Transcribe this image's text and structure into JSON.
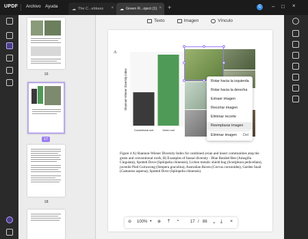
{
  "app": {
    "logo": "UPDF",
    "menu": [
      "Archivo",
      "Ayuda"
    ],
    "tabs": [
      {
        "label": "The C...ebkass"
      },
      {
        "label": "Green R...oject (1)"
      }
    ],
    "avatar_initial": "C"
  },
  "toolbar": {
    "text_label": "Texto",
    "image_label": "Imagen",
    "link_label": "Vínculo"
  },
  "thumbnails": {
    "pages": [
      "16",
      "17",
      "18"
    ],
    "selected_page": "17"
  },
  "document": {
    "figure_label": "A",
    "y_axis_label": "Shannon-Wiener Diversity Index",
    "x_categories": [
      "Conventional roof",
      "Green roof"
    ],
    "caption": "Figure 4 A) Shannon-Wiener Diversity Index for combined avian and insect communities atop the green and conventional roofs, B) Examples of faunal diversity - Blue Banded Bee (Amegilla Cingulata), Spotted Dove (Spilopelia chinensis), Lichen metalic shield bug (Scutiphora pedicellata), juvenile Pied Currawong (Strepera graculina), Australian Raven (Corvus coronoides), Garden Snail (Cantareus aspersa), Spotted Dove (Spilopelia chinensis)."
  },
  "chart_data": {
    "type": "bar",
    "categories": [
      "Conventional roof",
      "Green roof"
    ],
    "values": [
      0.47,
      1.0
    ],
    "ylabel": "Shannon-Wiener Diversity Index",
    "colors": [
      "#3a3a3a",
      "#4f9a57"
    ]
  },
  "context_menu": {
    "items": [
      {
        "label": "Rotar hacia la izquierda",
        "shortcut": ""
      },
      {
        "label": "Rotar hacia la derecha",
        "shortcut": ""
      },
      {
        "label": "Extraer imagen",
        "shortcut": ""
      },
      {
        "label": "Recortar imagen",
        "shortcut": ""
      },
      {
        "label": "Eliminar recorte",
        "shortcut": ""
      },
      {
        "label": "Reemplazar imagen",
        "shortcut": ""
      },
      {
        "label": "Eliminar imagen",
        "shortcut": "Del"
      }
    ],
    "highlighted": "Reemplazar imagen"
  },
  "navbar": {
    "zoom": "100%",
    "current_page": "17",
    "total_pages": "86",
    "separator": "/"
  },
  "colors": {
    "accent": "#9b7cf2",
    "titlebar": "#1b1b1b",
    "bar_dark": "#3a3a3a",
    "bar_green": "#4f9a57"
  }
}
